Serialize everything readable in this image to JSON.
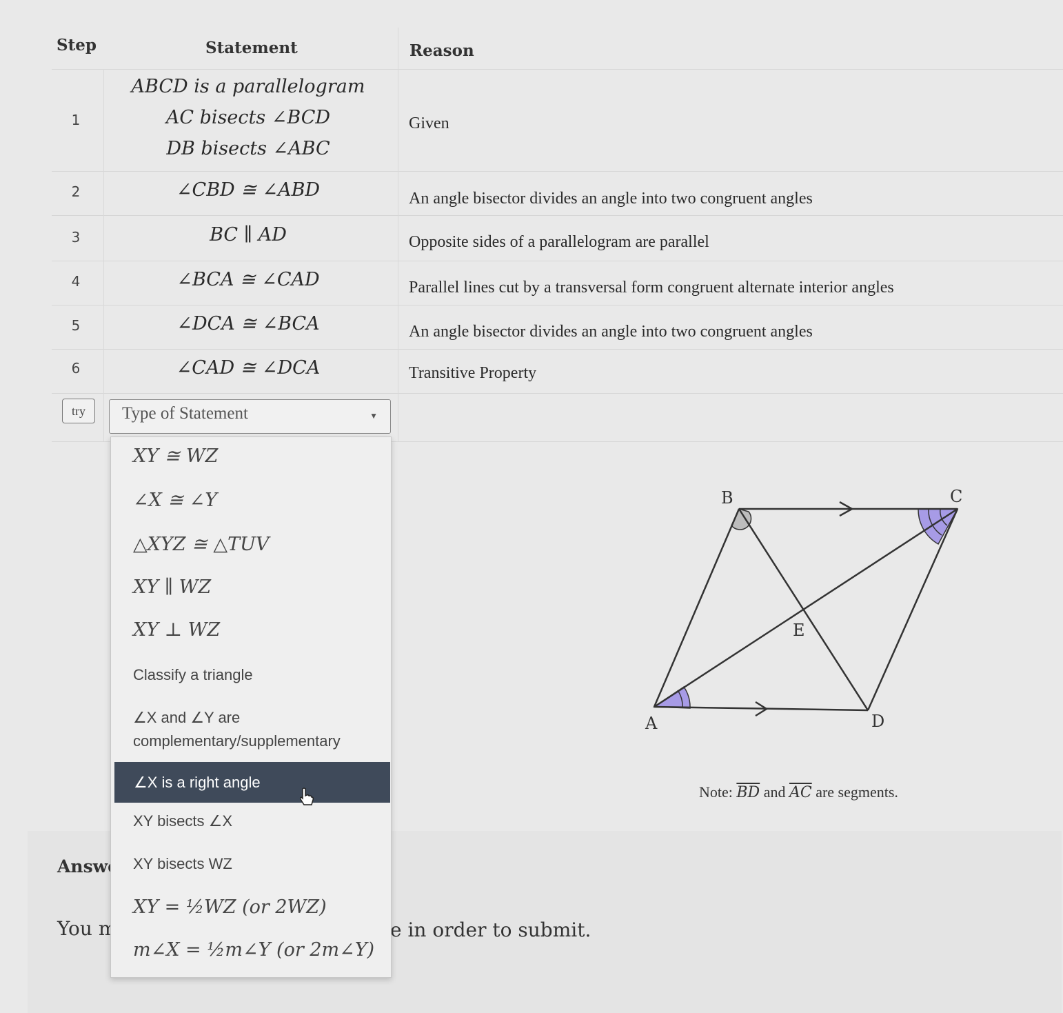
{
  "table": {
    "headers": {
      "step": "Step",
      "statement": "Statement",
      "reason": "Reason"
    },
    "rows": [
      {
        "step": "1",
        "statement_lines": [
          "ABCD is a parallelogram",
          "AC bisects ∠BCD",
          "DB bisects ∠ABC"
        ],
        "reason": "Given"
      },
      {
        "step": "2",
        "statement": "∠CBD ≅ ∠ABD",
        "reason": "An angle bisector divides an angle into two congruent angles"
      },
      {
        "step": "3",
        "statement": "BC ∥ AD",
        "reason": "Opposite sides of a parallelogram are parallel"
      },
      {
        "step": "4",
        "statement": "∠BCA ≅ ∠CAD",
        "reason": "Parallel lines cut by a transversal form congruent alternate interior angles"
      },
      {
        "step": "5",
        "statement": "∠DCA ≅ ∠BCA",
        "reason": "An angle bisector divides an angle into two congruent angles"
      },
      {
        "step": "6",
        "statement": "∠CAD ≅ ∠DCA",
        "reason": "Transitive Property"
      }
    ]
  },
  "try_row": {
    "try_label": "try",
    "select_placeholder": "Type of Statement"
  },
  "dropdown": {
    "options": [
      "XY ≅ WZ",
      "∠X ≅ ∠Y",
      "△XYZ ≅ △TUV",
      "XY ∥ WZ",
      "XY ⊥ WZ",
      "Classify a triangle",
      "∠X and ∠Y are complementary/supplementary",
      "∠X is a right angle",
      "XY bisects ∠X",
      "XY bisects WZ",
      "XY = ½WZ (or 2WZ)",
      "m∠X = ½m∠Y (or 2m∠Y)"
    ],
    "highlighted_index": 7
  },
  "diagram": {
    "labels": {
      "A": "A",
      "B": "B",
      "C": "C",
      "D": "D",
      "E": "E"
    },
    "colors": {
      "line": "#333333",
      "angle_gray": "#bdbdbd",
      "angle_purple": "#a79be6"
    }
  },
  "note": {
    "prefix": "Note:",
    "seg1": "BD",
    "and": "and",
    "seg2": "AC",
    "suffix": "are segments."
  },
  "answer": {
    "label": "Answe"
  },
  "submit": {
    "left": "You m",
    "right": "e in order to submit."
  }
}
